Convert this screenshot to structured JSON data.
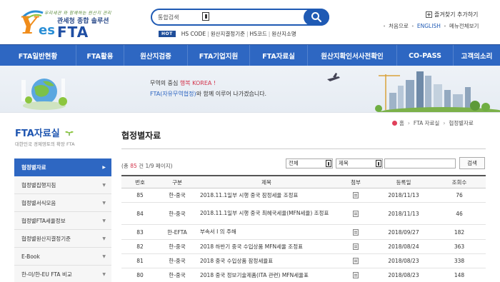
{
  "logo": {
    "tagline": "우리세관 와 함께하는 원산지 관리",
    "subtitle": "관세청 종합 솔루션",
    "brand_y": "Y",
    "brand_es": "es",
    "brand_fta": "FTA"
  },
  "search": {
    "placeholder": "통합검색",
    "value": "통합검색"
  },
  "hot": {
    "badge": "HOT",
    "links": [
      "HS CODE",
      "원산지결정기준",
      "HS코드",
      "원산지소명"
    ]
  },
  "favorites": {
    "label": "즐겨찾기 추가하기"
  },
  "utility": {
    "home": "처음으로",
    "english": "ENGLISH",
    "sitemap": "메뉴전체보기"
  },
  "nav": [
    {
      "label": "FTA일반현황"
    },
    {
      "label": "FTA활용"
    },
    {
      "label": "원산지검증"
    },
    {
      "label": "FTA기업지원"
    },
    {
      "label": "FTA자료실"
    },
    {
      "label": "원산지확인서사전확인"
    },
    {
      "label": "CO-PASS"
    },
    {
      "label": "고객의소리"
    }
  ],
  "banner": {
    "line1_prefix": "무역의 중심 ",
    "line1_highlight": "행복 KOREA !",
    "line2_highlight": "FTA(자유무역협정)",
    "line2_suffix": "와 함께 이루어 나가겠습니다."
  },
  "sidebar": {
    "title": "FTA자료실",
    "subtitle": "대한민국 경제영토의 확장 FTA",
    "items": [
      {
        "label": "협정별자료",
        "active": true
      },
      {
        "label": "협정별집행지침",
        "active": false
      },
      {
        "label": "협정별서식모음",
        "active": false
      },
      {
        "label": "협정별FTA세율정보",
        "active": false
      },
      {
        "label": "협정별원산지결정기준",
        "active": false
      },
      {
        "label": "E-Book",
        "active": false
      },
      {
        "label": "한-미/한-EU FTA 비교",
        "active": false
      }
    ]
  },
  "breadcrumb": {
    "home": "홈",
    "level1": "FTA 자료실",
    "level2": "협정별자료"
  },
  "page": {
    "title": "협정별자료"
  },
  "listing": {
    "count_prefix": "(총 ",
    "count_total": "85",
    "count_mid": " 건 ",
    "count_page": "1/9",
    "count_suffix": " 페이지)"
  },
  "filters": {
    "scope": "전체",
    "field": "제목",
    "keyword": "",
    "search_button": "검색"
  },
  "table": {
    "headers": [
      "번호",
      "구분",
      "제목",
      "첨부",
      "등록일",
      "조회수"
    ],
    "rows": [
      {
        "no": "85",
        "type": "한-중국",
        "title": "2018.11.1일부 시행 중국 잠정세율 조정표",
        "date": "2018/11/13",
        "views": "76"
      },
      {
        "no": "84",
        "type": "한-중국",
        "title": "2018.11.1일부 시행 중국 최혜국세율(MFN세율) 조정표",
        "date": "2018/11/13",
        "views": "46"
      },
      {
        "no": "83",
        "type": "한-EFTA",
        "title": "부속서 Ⅰ 의 주해",
        "date": "2018/09/27",
        "views": "182"
      },
      {
        "no": "82",
        "type": "한-중국",
        "title": "2018 하반기 중국 수입상품 MFN세율 조정표",
        "date": "2018/08/24",
        "views": "363"
      },
      {
        "no": "81",
        "type": "한-중국",
        "title": "2018 중국 수입상품 잠정세율표",
        "date": "2018/08/23",
        "views": "338"
      },
      {
        "no": "80",
        "type": "한-중국",
        "title": "2018 중국 정보기술제품(ITA 관련) MFN세율표",
        "date": "2018/08/23",
        "views": "148"
      }
    ]
  },
  "colors": {
    "nav_bg": "#2e67c2",
    "accent_red": "#d2334a",
    "brand_blue": "#1f4ea3",
    "brand_orange": "#f08c1a"
  }
}
